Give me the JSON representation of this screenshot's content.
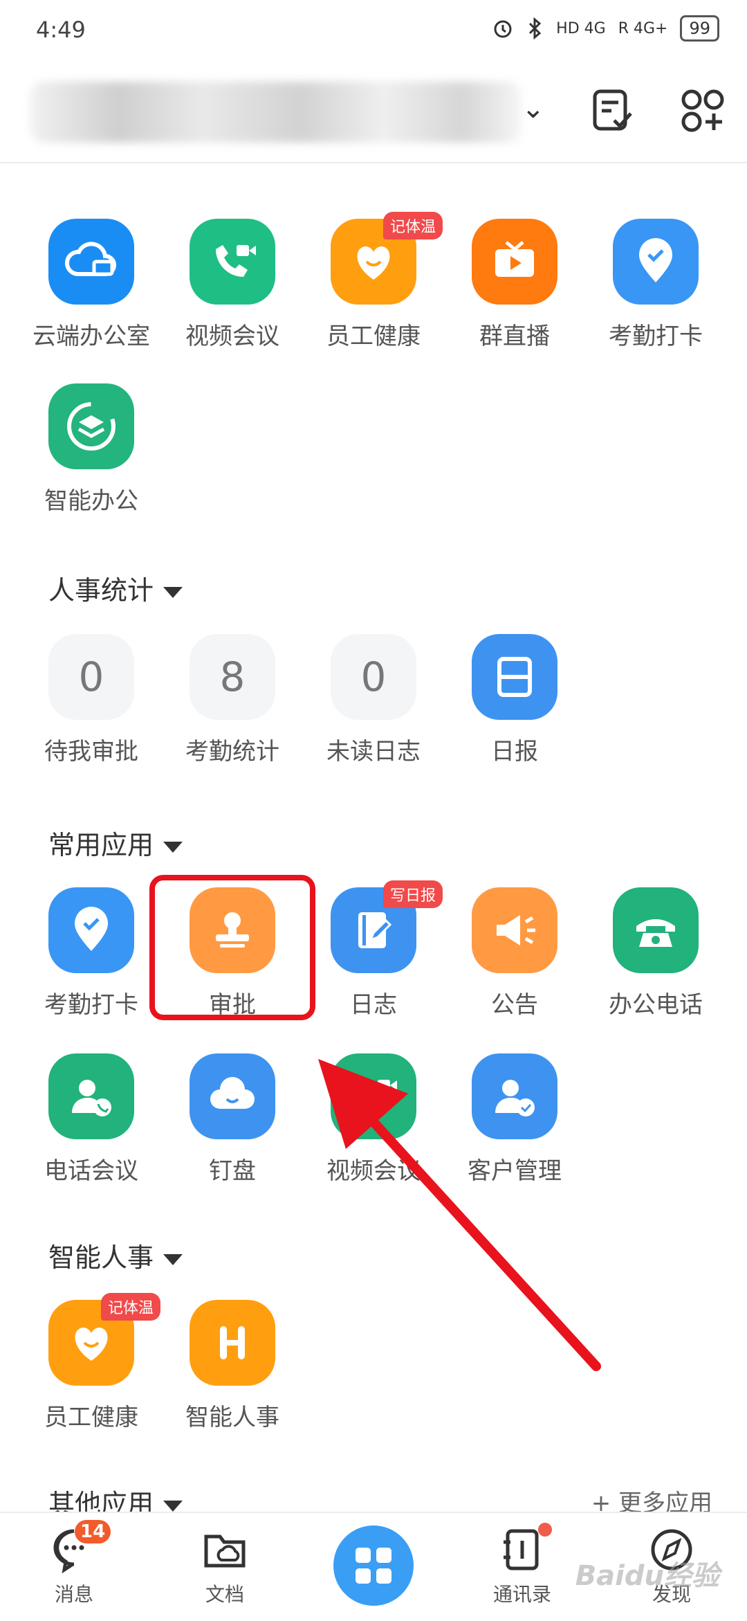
{
  "status_bar": {
    "time": "4:49",
    "signal1": "HD 4G",
    "signal2": "R 4G+",
    "battery": "99"
  },
  "toolbar": {
    "approve_note_icon": "note-check-icon",
    "add_app_icon": "apps-add-icon"
  },
  "top_apps": [
    {
      "label": "云端办公室",
      "icon": "cloud-desktop-icon",
      "color": "#1a8df5"
    },
    {
      "label": "视频会议",
      "icon": "video-call-icon",
      "color": "#1fbe85"
    },
    {
      "label": "员工健康",
      "icon": "heart-smile-icon",
      "color": "#ff9f0f",
      "badge": "记体温"
    },
    {
      "label": "群直播",
      "icon": "tv-play-icon",
      "color": "#ff7a0f"
    },
    {
      "label": "考勤打卡",
      "icon": "location-check-icon",
      "color": "#3996f5"
    },
    {
      "label": "智能办公",
      "icon": "layers-icon",
      "color": "#24b47e"
    }
  ],
  "hr_stats": {
    "title": "人事统计",
    "items": [
      {
        "value": "0",
        "label": "待我审批"
      },
      {
        "value": "8",
        "label": "考勤统计"
      },
      {
        "value": "0",
        "label": "未读日志"
      },
      {
        "label": "日报",
        "icon": "daily-report-icon"
      }
    ]
  },
  "common_apps": {
    "title": "常用应用",
    "items": [
      {
        "label": "考勤打卡",
        "icon": "location-check-icon",
        "color": "#3996f5"
      },
      {
        "label": "审批",
        "icon": "stamp-icon",
        "color": "#ff9a43"
      },
      {
        "label": "日志",
        "icon": "notebook-pen-icon",
        "color": "#3e93f0",
        "badge": "写日报"
      },
      {
        "label": "公告",
        "icon": "megaphone-icon",
        "color": "#ff9a43"
      },
      {
        "label": "办公电话",
        "icon": "telephone-icon",
        "color": "#22b27b"
      },
      {
        "label": "电话会议",
        "icon": "person-phone-icon",
        "color": "#22b27b"
      },
      {
        "label": "钉盘",
        "icon": "cloud-smile-icon",
        "color": "#3e93f0"
      },
      {
        "label": "视频会议",
        "icon": "video-call-icon",
        "color": "#22b27b"
      },
      {
        "label": "客户管理",
        "icon": "person-check-icon",
        "color": "#3e93f0"
      }
    ]
  },
  "smart_hr": {
    "title": "智能人事",
    "items": [
      {
        "label": "员工健康",
        "icon": "heart-smile-icon",
        "color": "#ff9f0f",
        "badge": "记体温"
      },
      {
        "label": "智能人事",
        "icon": "h-letter-icon",
        "color": "#ff9f0f"
      }
    ]
  },
  "other_apps": {
    "title": "其他应用",
    "more_link": "+ 更多应用"
  },
  "bottom_nav": {
    "items": [
      {
        "label": "消息",
        "icon": "chat-bubble-icon",
        "badge": "14"
      },
      {
        "label": "文档",
        "icon": "folder-cloud-icon"
      },
      {
        "label": "",
        "icon": "grid-apps-icon"
      },
      {
        "label": "通讯录",
        "icon": "contacts-book-icon"
      },
      {
        "label": "发现",
        "icon": "compass-icon"
      }
    ]
  },
  "annotation": {
    "highlight_color": "#e8131c"
  },
  "watermark": "Baidu经验"
}
